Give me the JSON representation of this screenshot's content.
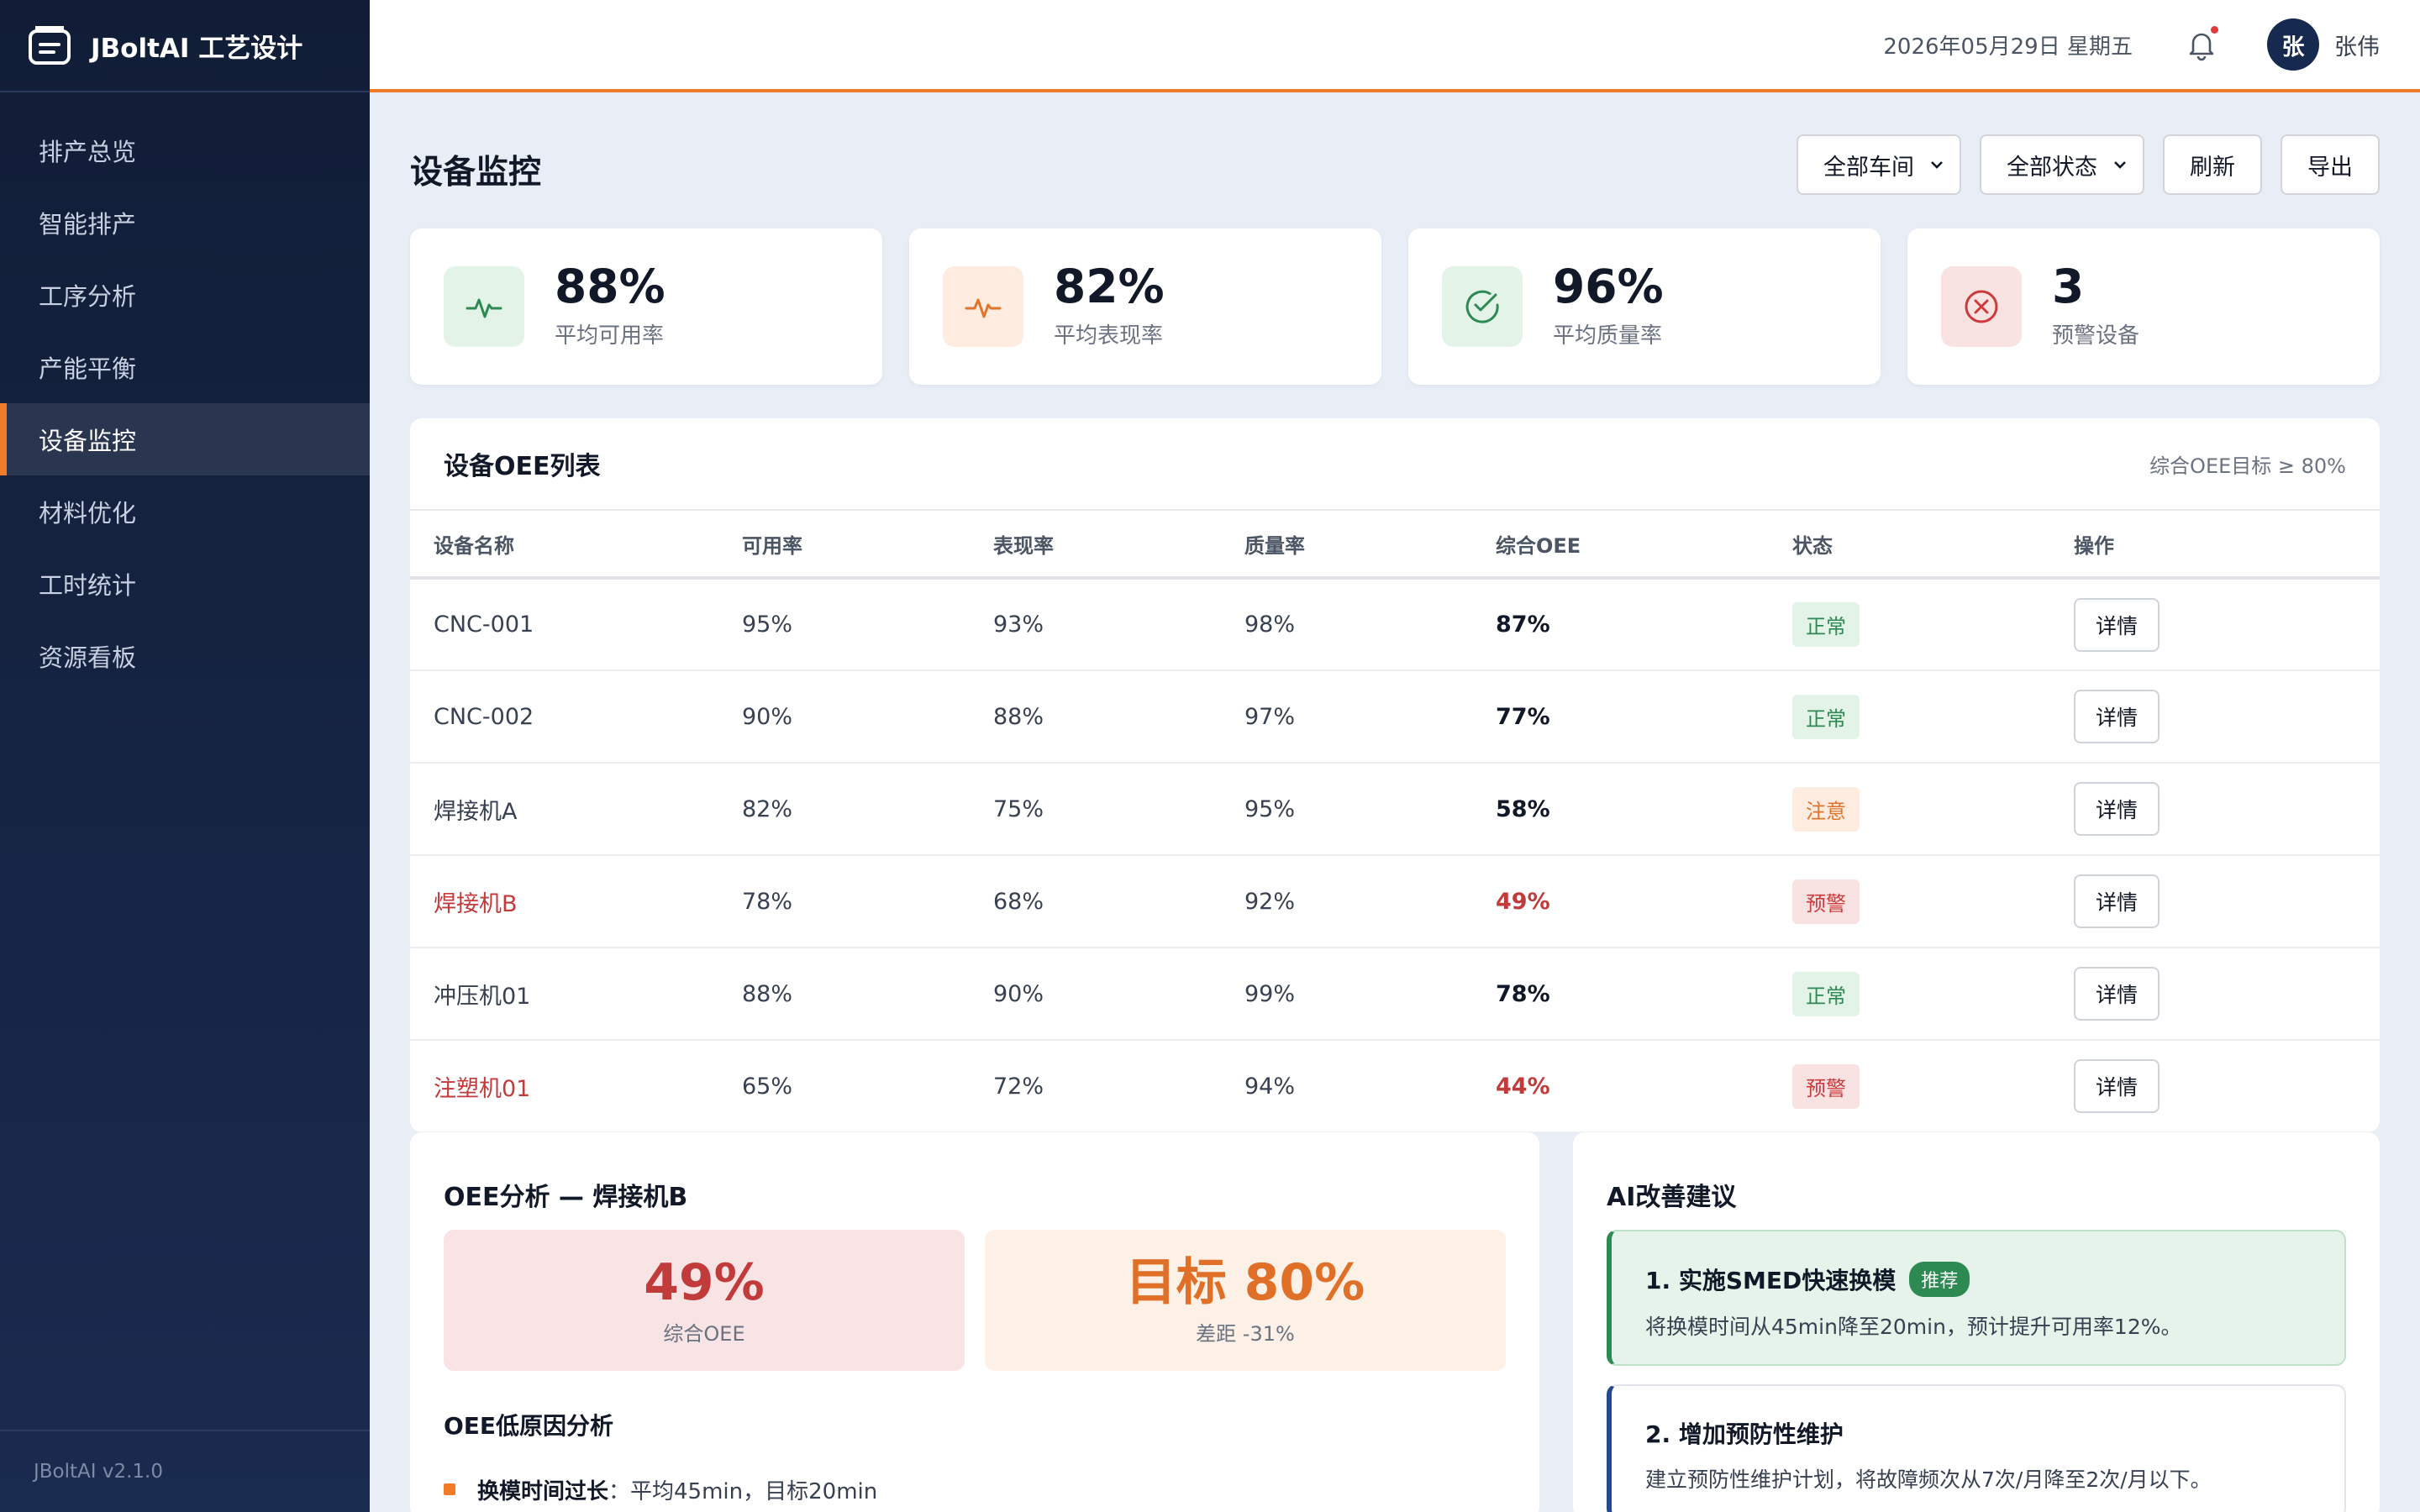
{
  "app": {
    "title": "JBoltAI 工艺设计",
    "version": "JBoltAI v2.1.0"
  },
  "sidebar": {
    "items": [
      {
        "label": "排产总览"
      },
      {
        "label": "智能排产"
      },
      {
        "label": "工序分析"
      },
      {
        "label": "产能平衡"
      },
      {
        "label": "设备监控",
        "active": true
      },
      {
        "label": "材料优化"
      },
      {
        "label": "工时统计"
      },
      {
        "label": "资源看板"
      }
    ]
  },
  "header": {
    "date": "2026年05月29日 星期五",
    "avatar_initial": "张",
    "username": "张伟"
  },
  "page": {
    "title": "设备监控",
    "workshop_filter": "全部车间",
    "status_filter": "全部状态",
    "refresh_label": "刷新",
    "export_label": "导出"
  },
  "stats": [
    {
      "value": "88%",
      "label": "平均可用率",
      "icon": "pulse-icon"
    },
    {
      "value": "82%",
      "label": "平均表现率",
      "icon": "pulse-icon"
    },
    {
      "value": "96%",
      "label": "平均质量率",
      "icon": "check-circle-icon"
    },
    {
      "value": "3",
      "label": "预警设备",
      "icon": "x-circle-icon"
    }
  ],
  "oee_table": {
    "title": "设备OEE列表",
    "note": "综合OEE目标 ≥ 80%",
    "columns": [
      "设备名称",
      "可用率",
      "表现率",
      "质量率",
      "综合OEE",
      "状态",
      "操作"
    ],
    "rows": [
      {
        "name": "CNC-001",
        "availability": "95%",
        "performance": "93%",
        "quality": "98%",
        "oee": "87%",
        "status": "正常",
        "action": "详情"
      },
      {
        "name": "CNC-002",
        "availability": "90%",
        "performance": "88%",
        "quality": "97%",
        "oee": "77%",
        "status": "正常",
        "action": "详情"
      },
      {
        "name": "焊接机A",
        "availability": "82%",
        "performance": "75%",
        "quality": "95%",
        "oee": "58%",
        "status": "注意",
        "action": "详情"
      },
      {
        "name": "焊接机B",
        "availability": "78%",
        "performance": "68%",
        "quality": "92%",
        "oee": "49%",
        "status": "预警",
        "action": "详情"
      },
      {
        "name": "冲压机01",
        "availability": "88%",
        "performance": "90%",
        "quality": "99%",
        "oee": "78%",
        "status": "正常",
        "action": "详情"
      },
      {
        "name": "注塑机01",
        "availability": "65%",
        "performance": "72%",
        "quality": "94%",
        "oee": "44%",
        "status": "预警",
        "action": "详情"
      }
    ]
  },
  "oee_analysis": {
    "title": "OEE分析 — 焊接机B",
    "current_value": "49%",
    "current_label": "综合OEE",
    "target_value": "目标 80%",
    "target_label": "差距 -31%",
    "causes_title": "OEE低原因分析",
    "causes": [
      {
        "name": "换模时间过长",
        "detail": "：平均45min，目标20min"
      }
    ]
  },
  "ai_suggestions": {
    "title": "AI改善建议",
    "items": [
      {
        "title": "1. 实施SMED快速换模",
        "tag": "推荐",
        "desc": "将换模时间从45min降至20min，预计提升可用率12%。"
      },
      {
        "title": "2. 增加预防性维护",
        "desc": "建立预防性维护计划，将故障频次从7次/月降至2次/月以下。"
      }
    ]
  },
  "colors": {
    "accent": "#f07c2a",
    "sidebar": "#111d36",
    "normal": "#2e8a53",
    "notice": "#e0742a",
    "warning": "#cc3b3b"
  }
}
